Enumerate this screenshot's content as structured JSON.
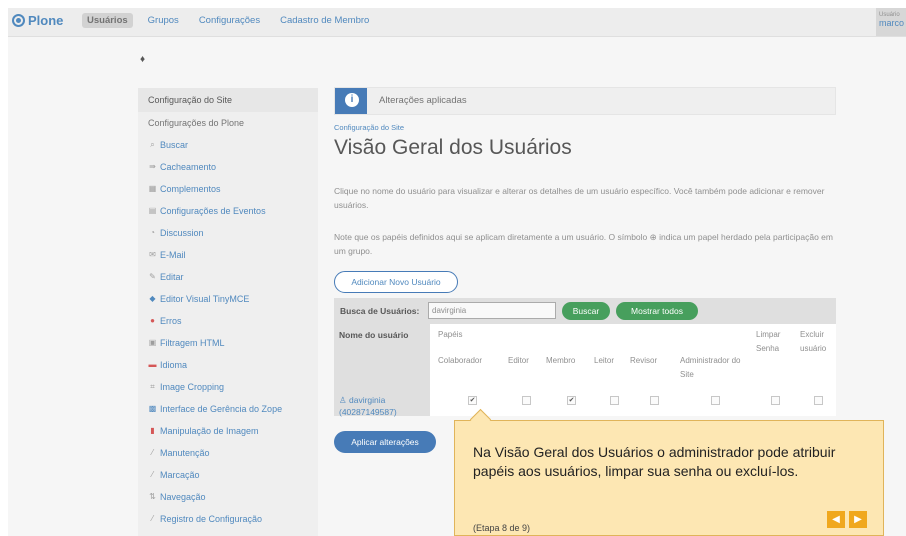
{
  "topbar": {
    "logo": "Plone",
    "nav": [
      "Usuários",
      "Grupos",
      "Configurações",
      "Cadastro de Membro"
    ],
    "user_label": "Usuário",
    "user_name": "marco"
  },
  "sidebar": {
    "header": "Configuração do Site",
    "subheader": "Configurações do Plone",
    "items": [
      {
        "label": "Buscar",
        "icon": "search-icon"
      },
      {
        "label": "Cacheamento",
        "icon": "cache-icon"
      },
      {
        "label": "Complementos",
        "icon": "addons-icon"
      },
      {
        "label": "Configurações de Eventos",
        "icon": "calendar-icon"
      },
      {
        "label": "Discussion",
        "icon": "discussion-icon"
      },
      {
        "label": "E-Mail",
        "icon": "mail-icon"
      },
      {
        "label": "Editar",
        "icon": "edit-icon"
      },
      {
        "label": "Editor Visual TinyMCE",
        "icon": "tinymce-icon"
      },
      {
        "label": "Erros",
        "icon": "error-icon"
      },
      {
        "label": "Filtragem HTML",
        "icon": "filter-icon"
      },
      {
        "label": "Idioma",
        "icon": "flag-icon"
      },
      {
        "label": "Image Cropping",
        "icon": "crop-icon"
      },
      {
        "label": "Interface de Gerência do Zope",
        "icon": "zope-icon"
      },
      {
        "label": "Manipulação de Imagem",
        "icon": "image-icon"
      },
      {
        "label": "Manutenção",
        "icon": "wrench-icon"
      },
      {
        "label": "Marcação",
        "icon": "markup-icon"
      },
      {
        "label": "Navegação",
        "icon": "navigation-icon"
      },
      {
        "label": "Registro de Configuração",
        "icon": "registry-icon"
      }
    ]
  },
  "main": {
    "notice": "Alterações aplicadas",
    "breadcrumb": "Configuração do Site",
    "title": "Visão Geral dos Usuários",
    "para1": "Clique no nome do usuário para visualizar e alterar os detalhes de um usuário específico. Você também pode adicionar e remover usuários.",
    "para2": "Note que os papéis definidos aqui se aplicam diretamente a um usuário. O símbolo ⊕ indica um papel herdado pela participação em um grupo.",
    "add_user": "Adicionar Novo Usuário",
    "search_label": "Busca de Usuários:",
    "search_value": "davirginia",
    "search_button": "Buscar",
    "show_all_button": "Mostrar todos",
    "apply_button": "Aplicar alterações"
  },
  "table": {
    "user_header": "Nome do usuário",
    "roles_header": "Papéis",
    "columns": [
      "Colaborador",
      "Editor",
      "Membro",
      "Leitor",
      "Revisor",
      "Administrador do Site",
      "Limpar Senha",
      "Excluir usuário"
    ],
    "row": {
      "user": "davirginia",
      "user_id": "(40287149587)",
      "checked": [
        true,
        false,
        true,
        false,
        false,
        false,
        false,
        false
      ]
    }
  },
  "tooltip": {
    "message": "Na Visão Geral dos Usuários o administrador pode atribuir papéis aos usuários, limpar sua senha ou excluí-los.",
    "step": "(Etapa 8 de 9)",
    "prev": "◀",
    "next": "▶"
  },
  "colors": {
    "accent": "#1f5fa8",
    "green": "#1f8a3a",
    "tooltip_bg": "#fde7b3",
    "tooltip_btn": "#f0a81e"
  }
}
